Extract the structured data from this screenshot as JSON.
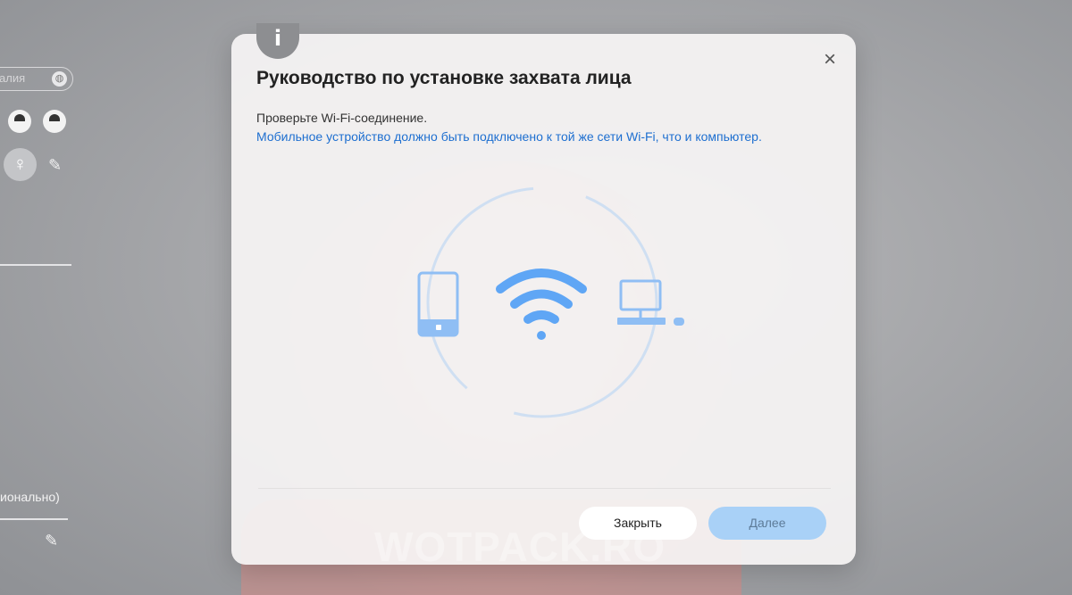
{
  "background": {
    "search_placeholder": "алия",
    "side_text": "ионально)"
  },
  "dialog": {
    "info_icon": "info-icon",
    "info_glyph": "i",
    "close_glyph": "×",
    "title": "Руководство по установке захвата лица",
    "line1": "Проверьте Wi-Fi-соединение.",
    "line2": "Мобильное устройство должно быть подключено к той же сети Wi-Fi, что и компьютер.",
    "illustration_icons": [
      "phone-icon",
      "wifi-icon",
      "computer-icon"
    ],
    "buttons": {
      "close": "Закрыть",
      "next": "Далее"
    },
    "watermark": "WOTPACK.RO"
  },
  "colors": {
    "accent": "#1e6fd0",
    "icon_blue": "#5fa6f5",
    "next_button": "#a9d1f7"
  }
}
